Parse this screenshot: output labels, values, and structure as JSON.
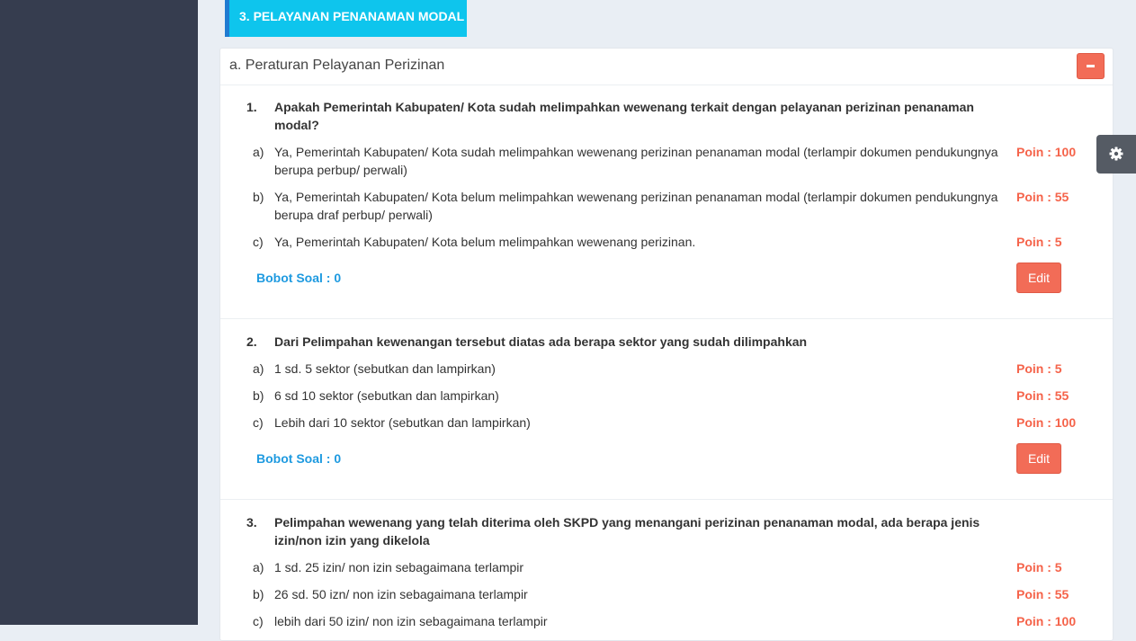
{
  "section_tab": "3. PELAYANAN PENANAMAN MODAL",
  "panel": {
    "title": "a. Peraturan Pelayanan Perizinan"
  },
  "questions": [
    {
      "number": "1.",
      "text": "Apakah Pemerintah Kabupaten/ Kota sudah melimpahkan wewenang terkait dengan pelayanan perizinan penanaman modal?",
      "options": [
        {
          "letter": "a)",
          "text": "Ya, Pemerintah Kabupaten/ Kota sudah melimpahkan wewenang perizinan penanaman modal (terlampir dokumen pendukungnya berupa perbup/ perwali)",
          "poin": "Poin : 100"
        },
        {
          "letter": "b)",
          "text": "Ya, Pemerintah Kabupaten/ Kota belum melimpahkan wewenang perizinan penanaman modal (terlampir dokumen pendukungnya berupa draf perbup/ perwali)",
          "poin": "Poin : 55"
        },
        {
          "letter": "c)",
          "text": "Ya, Pemerintah Kabupaten/ Kota belum melimpahkan wewenang perizinan.",
          "poin": "Poin : 5"
        }
      ],
      "bobot": "Bobot Soal : 0",
      "edit_label": "Edit"
    },
    {
      "number": "2.",
      "text": "Dari Pelimpahan kewenangan tersebut diatas ada berapa sektor yang sudah dilimpahkan",
      "options": [
        {
          "letter": "a)",
          "text": "1 sd. 5 sektor (sebutkan dan lampirkan)",
          "poin": "Poin : 5"
        },
        {
          "letter": "b)",
          "text": "6 sd 10 sektor (sebutkan dan lampirkan)",
          "poin": "Poin : 55"
        },
        {
          "letter": "c)",
          "text": "Lebih dari 10 sektor (sebutkan dan lampirkan)",
          "poin": "Poin : 100"
        }
      ],
      "bobot": "Bobot Soal : 0",
      "edit_label": "Edit"
    },
    {
      "number": "3.",
      "text": "Pelimpahan wewenang yang telah diterima oleh SKPD yang menangani perizinan penanaman modal, ada berapa jenis izin/non izin yang dikelola",
      "options": [
        {
          "letter": "a)",
          "text": "1 sd. 25 izin/ non izin sebagaimana terlampir",
          "poin": "Poin : 5"
        },
        {
          "letter": "b)",
          "text": "26 sd. 50 izn/ non izin sebagaimana terlampir",
          "poin": "Poin : 55"
        },
        {
          "letter": "c)",
          "text": "lebih dari 50 izin/ non izin sebagaimana terlampir",
          "poin": "Poin : 100"
        }
      ]
    }
  ],
  "icons": {
    "collapse": "minus-icon",
    "settings": "gear-icon"
  },
  "colors": {
    "sidebar": "#363d4f",
    "tab": "#0ec5ed",
    "danger": "#f26c57",
    "poin": "#f5634a",
    "bobot": "#1e9ae0"
  }
}
